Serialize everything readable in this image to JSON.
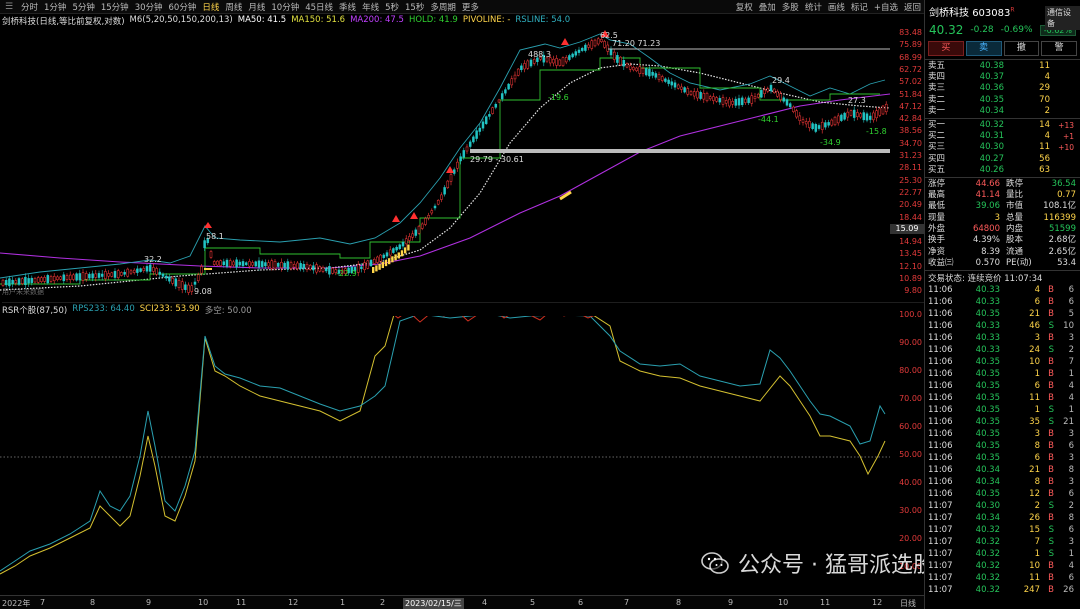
{
  "toolbar": {
    "left_items": [
      "分时",
      "1分钟",
      "5分钟",
      "15分钟",
      "30分钟",
      "60分钟",
      "日线",
      "周线",
      "月线",
      "10分钟",
      "45日线",
      "季线",
      "年线",
      "5秒",
      "15秒",
      "多周期",
      "更多"
    ],
    "active_index": 6,
    "right_items": [
      "复权",
      "叠加",
      "多股",
      "统计",
      "画线",
      "标记",
      "+自选",
      "返回"
    ]
  },
  "main_legend": {
    "name": "剑桥科技(日线,等比前复权,对数)",
    "ma6": "M6(5,20,50,150,200,13)",
    "ma50": "MA50: 41.5",
    "ma150": "MA150: 51.6",
    "ma200": "MA200: 47.5",
    "hold": "HOLD: 41.9",
    "pivoline": "PIVOLINE: -",
    "rsline": "RSLINE: 54.0",
    "colors": {
      "ma50": "#ffffff",
      "ma150": "#e0e040",
      "ma200": "#c040ff",
      "hold": "#30d030",
      "pivoline": "#ffd54a",
      "rsline": "#30b0c0"
    }
  },
  "price_axis": {
    "labels": [
      "83.48",
      "75.89",
      "68.99",
      "62.72",
      "57.02",
      "51.84",
      "47.12",
      "42.84",
      "38.56",
      "34.70",
      "31.23",
      "28.11",
      "25.30",
      "22.77",
      "20.49",
      "18.44",
      "16.60",
      "14.94",
      "13.45",
      "12.10",
      "10.89",
      "9.80"
    ],
    "gray_label": "15.09"
  },
  "annotations": {
    "p58": "58.1",
    "p32": "32.2",
    "p908": "9.08",
    "m229": "-22.9",
    "p883": "488.3",
    "p625": "62.5",
    "range1": "71.20 71.23",
    "m196": "-19.6",
    "band": "29.79 - 30.61",
    "p294": "29.4",
    "m441": "-44.1",
    "m349": "-34.9",
    "p273": "27.3",
    "m158": "-15.8",
    "watermark_small": "用户未来数据"
  },
  "sub_legend": {
    "name": "RSR个股(87,50)",
    "rps": "RPS233: 64.40",
    "sci": "SCI233: 53.90",
    "hold": "多空: 50.00"
  },
  "sub_axis": {
    "labels": [
      "100.0",
      "90.00",
      "80.00",
      "70.00",
      "60.00",
      "50.00",
      "40.00",
      "30.00",
      "20.00",
      "10.00"
    ]
  },
  "date_axis": {
    "labels": [
      "2022年",
      "7",
      "8",
      "9",
      "10",
      "11",
      "12",
      "1",
      "2",
      "2023/02/15/三",
      "4",
      "5",
      "6",
      "7",
      "8",
      "9",
      "10",
      "11",
      "12"
    ],
    "period": "日线"
  },
  "panel": {
    "title": "剑桥科技",
    "code": "603083",
    "code_tag": "R",
    "tongxin": "通信设备",
    "last": "40.32",
    "chg": "-0.28",
    "pct": "-0.69%",
    "sector_pct": "-0.62%",
    "actions": [
      "买",
      "卖",
      "撤",
      "警"
    ],
    "asks": [
      {
        "label": "卖五",
        "price": "40.38",
        "vol": "11"
      },
      {
        "label": "卖四",
        "price": "40.37",
        "vol": "4"
      },
      {
        "label": "卖三",
        "price": "40.36",
        "vol": "29"
      },
      {
        "label": "卖二",
        "price": "40.35",
        "vol": "70"
      },
      {
        "label": "卖一",
        "price": "40.34",
        "vol": "2"
      }
    ],
    "bids": [
      {
        "label": "买一",
        "price": "40.32",
        "vol": "14",
        "delta": "+13"
      },
      {
        "label": "买二",
        "price": "40.31",
        "vol": "4",
        "delta": "+1"
      },
      {
        "label": "买三",
        "price": "40.30",
        "vol": "11",
        "delta": "+10"
      },
      {
        "label": "买四",
        "price": "40.27",
        "vol": "56",
        "delta": ""
      },
      {
        "label": "买五",
        "price": "40.26",
        "vol": "63",
        "delta": ""
      }
    ],
    "stats": [
      {
        "k": "涨停",
        "v": "44.66",
        "vc": "red",
        "k2": "跌停",
        "v2": "36.54",
        "v2c": "green"
      },
      {
        "k": "最高",
        "v": "41.14",
        "vc": "red",
        "k2": "量比",
        "v2": "0.77",
        "v2c": "yellow"
      },
      {
        "k": "最低",
        "v": "39.06",
        "vc": "green",
        "k2": "市值",
        "v2": "108.1亿",
        "v2c": "white"
      },
      {
        "k": "现量",
        "v": "3",
        "vc": "yellow",
        "k2": "总量",
        "v2": "116399",
        "v2c": "yellow"
      },
      {
        "k": "外盘",
        "v": "64800",
        "vc": "red",
        "k2": "内盘",
        "v2": "51599",
        "v2c": "green"
      },
      {
        "k": "换手",
        "v": "4.39%",
        "vc": "white",
        "k2": "股本",
        "v2": "2.68亿",
        "v2c": "white"
      },
      {
        "k": "净资",
        "v": "8.39",
        "vc": "white",
        "k2": "流通",
        "v2": "2.65亿",
        "v2c": "white"
      },
      {
        "k": "收益㈢",
        "v": "0.570",
        "vc": "white",
        "k2": "PE(动)",
        "v2": "53.4",
        "v2c": "white"
      }
    ],
    "trade_status": "交易状态: 连续竞价 11:07:34",
    "ticks": [
      {
        "t": "11:06",
        "p": "40.33",
        "q": "4",
        "s": "B",
        "n": "6"
      },
      {
        "t": "11:06",
        "p": "40.33",
        "q": "6",
        "s": "B",
        "n": "6"
      },
      {
        "t": "11:06",
        "p": "40.35",
        "q": "21",
        "s": "B",
        "n": "5"
      },
      {
        "t": "11:06",
        "p": "40.33",
        "q": "46",
        "s": "S",
        "n": "10"
      },
      {
        "t": "11:06",
        "p": "40.33",
        "q": "3",
        "s": "B",
        "n": "3"
      },
      {
        "t": "11:06",
        "p": "40.33",
        "q": "24",
        "s": "S",
        "n": "2"
      },
      {
        "t": "11:06",
        "p": "40.35",
        "q": "10",
        "s": "B",
        "n": "7"
      },
      {
        "t": "11:06",
        "p": "40.35",
        "q": "1",
        "s": "B",
        "n": "1"
      },
      {
        "t": "11:06",
        "p": "40.35",
        "q": "6",
        "s": "B",
        "n": "4"
      },
      {
        "t": "11:06",
        "p": "40.35",
        "q": "11",
        "s": "B",
        "n": "4"
      },
      {
        "t": "11:06",
        "p": "40.35",
        "q": "1",
        "s": "S",
        "n": "1"
      },
      {
        "t": "11:06",
        "p": "40.35",
        "q": "35",
        "s": "S",
        "n": "21"
      },
      {
        "t": "11:06",
        "p": "40.35",
        "q": "3",
        "s": "B",
        "n": "3"
      },
      {
        "t": "11:06",
        "p": "40.35",
        "q": "8",
        "s": "B",
        "n": "6"
      },
      {
        "t": "11:06",
        "p": "40.35",
        "q": "6",
        "s": "B",
        "n": "3"
      },
      {
        "t": "11:06",
        "p": "40.34",
        "q": "21",
        "s": "B",
        "n": "8"
      },
      {
        "t": "11:06",
        "p": "40.34",
        "q": "8",
        "s": "B",
        "n": "3"
      },
      {
        "t": "11:06",
        "p": "40.35",
        "q": "12",
        "s": "B",
        "n": "6"
      },
      {
        "t": "11:07",
        "p": "40.30",
        "q": "2",
        "s": "S",
        "n": "2"
      },
      {
        "t": "11:07",
        "p": "40.34",
        "q": "26",
        "s": "B",
        "n": "8"
      },
      {
        "t": "11:07",
        "p": "40.32",
        "q": "15",
        "s": "S",
        "n": "6"
      },
      {
        "t": "11:07",
        "p": "40.32",
        "q": "7",
        "s": "S",
        "n": "3"
      },
      {
        "t": "11:07",
        "p": "40.32",
        "q": "1",
        "s": "S",
        "n": "1"
      },
      {
        "t": "11:07",
        "p": "40.32",
        "q": "10",
        "s": "B",
        "n": "4"
      },
      {
        "t": "11:07",
        "p": "40.32",
        "q": "11",
        "s": "B",
        "n": "6"
      },
      {
        "t": "11:07",
        "p": "40.32",
        "q": "247",
        "s": "B",
        "n": "26"
      }
    ]
  },
  "watermark": {
    "text": "公众号 · 猛哥派选股"
  }
}
